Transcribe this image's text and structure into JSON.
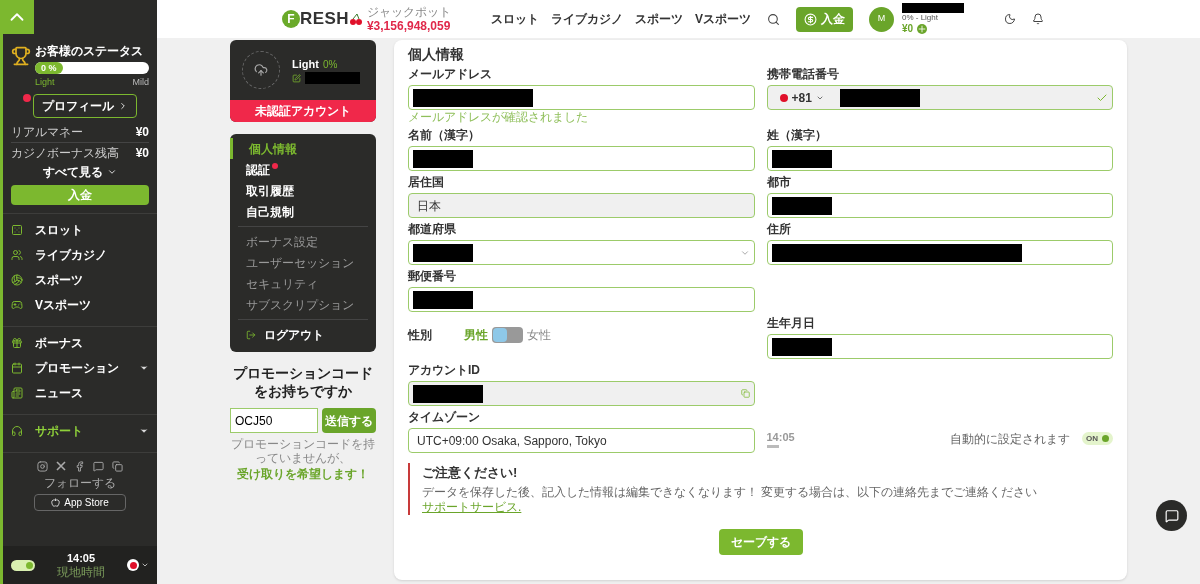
{
  "sidebar": {
    "status": {
      "title": "お客様のステータス",
      "percent": "0 %",
      "level": 0,
      "from": "Light",
      "to": "Mild"
    },
    "profile_button": {
      "label": "プロフィール",
      "alert": true
    },
    "balances": [
      {
        "label": "リアルマネー",
        "value": "¥0"
      },
      {
        "label": "カジノボーナス残高",
        "value": "¥0"
      }
    ],
    "see_all": "すべて見る",
    "deposit": "入金",
    "groups": [
      [
        {
          "label": "スロット",
          "expandable": false,
          "highlight": false
        },
        {
          "label": "ライブカジノ",
          "expandable": false,
          "highlight": false
        },
        {
          "label": "スポーツ",
          "expandable": false,
          "highlight": false
        },
        {
          "label": "Vスポーツ",
          "expandable": false,
          "highlight": false
        }
      ],
      [
        {
          "label": "ボーナス",
          "expandable": false,
          "highlight": false
        },
        {
          "label": "プロモーション",
          "expandable": true,
          "highlight": false
        },
        {
          "label": "ニュース",
          "expandable": false,
          "highlight": false
        }
      ],
      [
        {
          "label": "サポート",
          "expandable": true,
          "highlight": true
        }
      ]
    ],
    "follow": "フォローする",
    "app_store": "App Store",
    "time": "14:05",
    "time_caption": "現地時間",
    "theme_toggle": {
      "on": true
    }
  },
  "header": {
    "logo_mark": "F",
    "logo": "RESH",
    "jackpot_label": "ジャックポット",
    "jackpot": "¥3,156,948,059",
    "nav": [
      "スロット",
      "ライブカジノ",
      "スポーツ",
      "Vスポーツ"
    ],
    "deposit": "入金",
    "avatar": "M",
    "level": "0% - Light",
    "balance": "¥0"
  },
  "profile_card": {
    "level": "Light",
    "percent": "0%",
    "status": "未認証アカウント"
  },
  "account_menu": [
    [
      {
        "label": "個人情報",
        "selected": true,
        "alert": false
      },
      {
        "label": "認証",
        "selected": false,
        "alert": true
      },
      {
        "label": "取引履歴",
        "selected": false,
        "alert": false
      },
      {
        "label": "自己規制",
        "selected": false,
        "alert": false
      }
    ],
    [
      {
        "label": "ボーナス設定",
        "selected": false,
        "alert": false
      },
      {
        "label": "ユーザーセッション",
        "selected": false,
        "alert": false
      },
      {
        "label": "セキュリティ",
        "selected": false,
        "alert": false
      },
      {
        "label": "サブスクリプション",
        "selected": false,
        "alert": false
      }
    ]
  ],
  "logout": "ログアウト",
  "promo": {
    "title": "プロモーションコードをお持ちですか",
    "value": "OCJ50",
    "submit": "送信する",
    "note": "プロモーションコードを持っていませんが、",
    "link": "受け取りを希望します！"
  },
  "form": {
    "title": "個人情報",
    "rows": [
      [
        {
          "kind": "text",
          "label": "メールアドレス",
          "redacted": true,
          "readonly": false,
          "hint": "メールアドレスが確認されました"
        },
        {
          "kind": "phone",
          "label": "携帯電話番号",
          "code": "+81",
          "redacted": true,
          "readonly": true,
          "verified": true
        }
      ],
      [
        {
          "kind": "text",
          "label": "名前（漢字）",
          "redacted": true,
          "readonly": false
        },
        {
          "kind": "text",
          "label": "姓（漢字）",
          "redacted": true,
          "readonly": false
        }
      ],
      [
        {
          "kind": "text",
          "label": "居住国",
          "value": "日本",
          "redacted": false,
          "readonly": true
        },
        {
          "kind": "text",
          "label": "都市",
          "redacted": true,
          "readonly": false
        }
      ],
      [
        {
          "kind": "select",
          "label": "都道府県",
          "redacted": true,
          "readonly": false
        },
        {
          "kind": "text",
          "label": "住所",
          "redacted": true,
          "readonly": false,
          "wide": true
        }
      ],
      [
        {
          "kind": "text",
          "label": "郵便番号",
          "redacted": true,
          "readonly": false
        }
      ]
    ],
    "gender": {
      "label": "性別",
      "options": [
        {
          "label": "男性",
          "selected": true
        },
        {
          "label": "女性",
          "selected": false
        }
      ]
    },
    "birth": {
      "label": "生年月日",
      "redacted": true
    },
    "account_id": {
      "label": "アカウントID",
      "redacted": true
    },
    "timezone": {
      "label": "タイムゾーン",
      "value": "UTC+09:00 Osaka, Sapporo, Tokyo",
      "time": "14:05",
      "auto_label": "自動的に設定されます",
      "auto": {
        "on": true,
        "label": "ON"
      }
    },
    "notice": {
      "title": "ご注意ください!",
      "text": "データを保存した後、記入した情報は編集できなくなります！ 変更する場合は、以下の連絡先までご連絡ください",
      "link": "サポートサービス."
    },
    "save": "セーブする"
  }
}
